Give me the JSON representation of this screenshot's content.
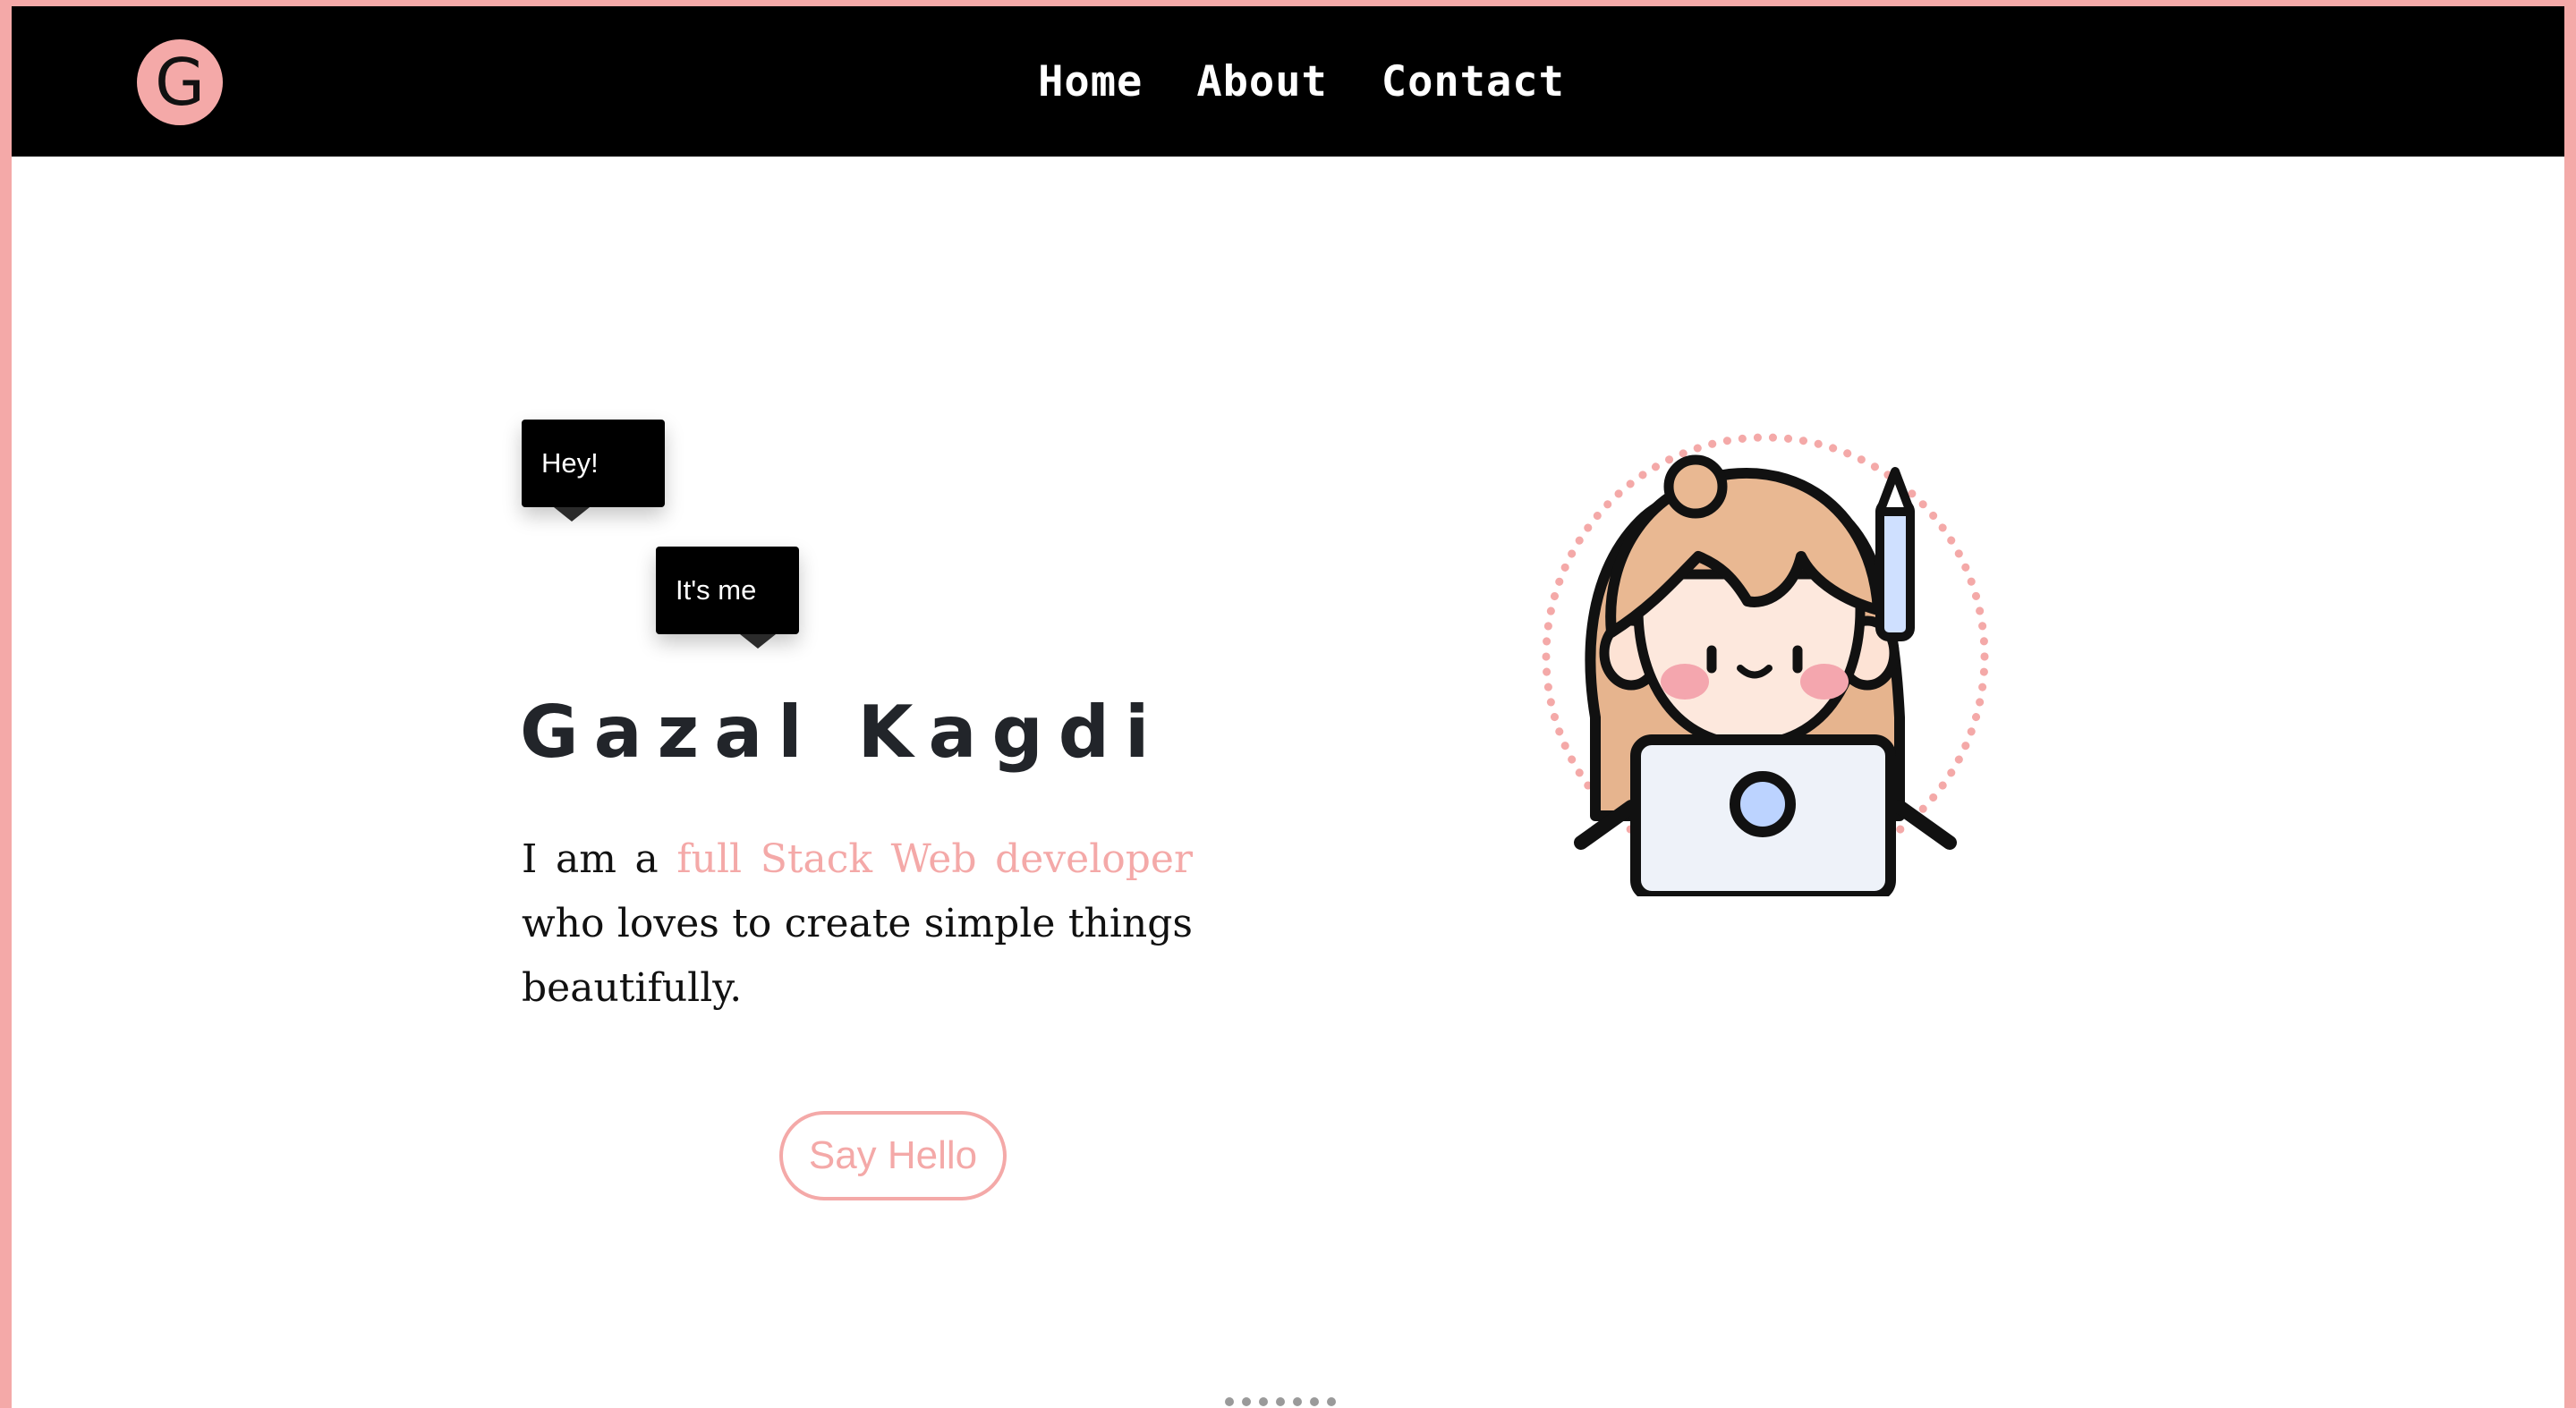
{
  "header": {
    "logo_letter": "G",
    "nav": [
      {
        "label": "Home"
      },
      {
        "label": "About"
      },
      {
        "label": "Contact"
      }
    ]
  },
  "hero": {
    "bubbles": [
      "Hey!",
      "It's me"
    ],
    "name": "Gazal Kagdi",
    "bio_prefix": "I am a ",
    "bio_highlight": "full Stack Web developer",
    "bio_suffix": " who loves to create simple things beautifully.",
    "cta_label": "Say Hello",
    "avatar_icon": "girl-with-laptop-illustration"
  },
  "colors": {
    "accent": "#f4a9a8",
    "navbar": "#000000",
    "name_text": "#22252a"
  }
}
